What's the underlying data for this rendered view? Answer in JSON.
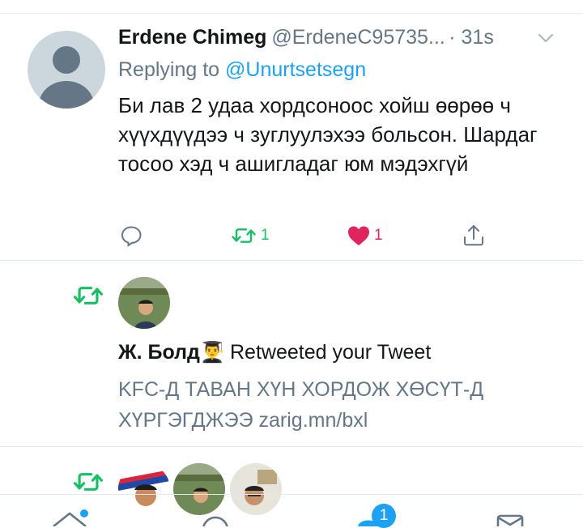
{
  "tweet": {
    "author_name": "Erdene Chimeg",
    "author_handle": "@ErdeneC95735...",
    "time": "· 31s",
    "reply_prefix": "Replying to",
    "reply_to": "@Unurtsetsegn",
    "text": "Би лав 2 удаа хордсоноос хойш өөрөө ч хүүхдүүдээ ч зуглуулэхээ больсон. Шардаг тосоо хэд ч ашигладаг юм мэдэхгүй",
    "retweet_count": "1",
    "like_count": "1"
  },
  "notification": {
    "actor": "Ж. Болд👨‍🎓",
    "verb": "Retweeted your Tweet",
    "tweet_text": "KFC-Д ТАВАН ХҮН ХОРДОЖ ХӨСҮТ-Д ХҮРГЭГДЖЭЭ zarig.mn/bxl"
  },
  "bottom_nav": {
    "badge_count": "1",
    "items": [
      "home-icon",
      "search-icon",
      "notifications-icon",
      "messages-icon"
    ]
  },
  "colors": {
    "accent": "#1da1f2",
    "retweet_green": "#17bf63",
    "like_red": "#e0245e",
    "secondary_text": "#657786"
  }
}
